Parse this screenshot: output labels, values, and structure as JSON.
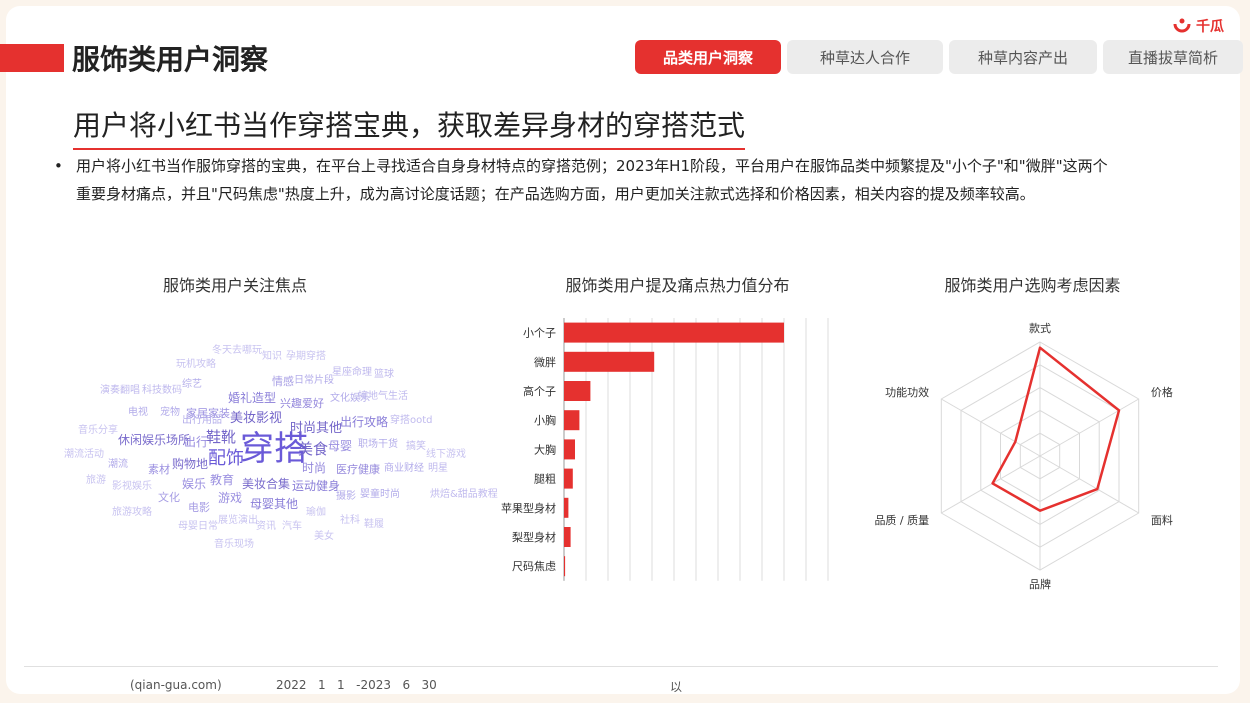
{
  "header": {
    "title": "服饰类用户洞察",
    "logo_text": "千瓜",
    "tabs": [
      {
        "label": "品类用户洞察",
        "active": true
      },
      {
        "label": "种草达人合作",
        "active": false
      },
      {
        "label": "种草内容产出",
        "active": false
      },
      {
        "label": "直播拔草简析",
        "active": false
      }
    ]
  },
  "headline": "用户将小红书当作穿搭宝典，获取差异身材的穿搭范式",
  "bullet": "用户将小红书当作服饰穿搭的宝典，在平台上寻找适合自身身材特点的穿搭范例；2023年H1阶段，平台用户在服饰品类中频繁提及\"小个子\"和\"微胖\"这两个重要身材痛点，并且\"尺码焦虑\"热度上升，成为高讨论度话题；在产品选购方面，用户更加关注款式选择和价格因素，相关内容的提及频率较高。",
  "wordcloud": {
    "title": "服饰类用户关注焦点",
    "words": [
      {
        "text": "穿搭",
        "size": 34,
        "color": "#6a5ad8"
      },
      {
        "text": "配饰",
        "size": 18,
        "color": "#6a5ad8"
      },
      {
        "text": "鞋靴",
        "size": 15,
        "color": "#7466c9"
      },
      {
        "text": "美食",
        "size": 15,
        "color": "#7466c9"
      },
      {
        "text": "美妆影视",
        "size": 13,
        "color": "#7466c9"
      },
      {
        "text": "时尚其他",
        "size": 13,
        "color": "#7466c9"
      },
      {
        "text": "美妆合集",
        "size": 12,
        "color": "#7a6ccc"
      },
      {
        "text": "购物地",
        "size": 12,
        "color": "#7a6ccc"
      },
      {
        "text": "休闲娱乐场所",
        "size": 12,
        "color": "#7a6ccc"
      },
      {
        "text": "婚礼造型",
        "size": 12,
        "color": "#8a7ed8"
      },
      {
        "text": "出行攻略",
        "size": 12,
        "color": "#8a7ed8"
      },
      {
        "text": "运动健身",
        "size": 12,
        "color": "#8a7ed8"
      },
      {
        "text": "母婴其他",
        "size": 12,
        "color": "#8a7ed8"
      },
      {
        "text": "医疗健康",
        "size": 11,
        "color": "#9488dc"
      },
      {
        "text": "时尚",
        "size": 12,
        "color": "#9488dc"
      },
      {
        "text": "兴趣爱好",
        "size": 11,
        "color": "#9488dc"
      },
      {
        "text": "家居家装",
        "size": 11,
        "color": "#9a8fe0"
      },
      {
        "text": "教育",
        "size": 12,
        "color": "#9a8fe0"
      },
      {
        "text": "娱乐",
        "size": 12,
        "color": "#9a8fe0"
      },
      {
        "text": "游戏",
        "size": 12,
        "color": "#9a8fe0"
      },
      {
        "text": "出行",
        "size": 12,
        "color": "#9a8fe0"
      },
      {
        "text": "母婴",
        "size": 12,
        "color": "#9a8fe0"
      },
      {
        "text": "素材",
        "size": 11,
        "color": "#9a8fe0"
      },
      {
        "text": "文化",
        "size": 11,
        "color": "#a79ee4"
      },
      {
        "text": "电影",
        "size": 11,
        "color": "#a79ee4"
      },
      {
        "text": "情感",
        "size": 11,
        "color": "#a79ee4"
      },
      {
        "text": "日常片段",
        "size": 10,
        "color": "#b3acea"
      },
      {
        "text": "文化娱乐",
        "size": 10,
        "color": "#b3acea"
      },
      {
        "text": "综艺",
        "size": 10,
        "color": "#b3acea"
      },
      {
        "text": "出行用品",
        "size": 10,
        "color": "#b3acea"
      },
      {
        "text": "宠物",
        "size": 10,
        "color": "#b3acea"
      },
      {
        "text": "电视",
        "size": 10,
        "color": "#b3acea"
      },
      {
        "text": "潮流",
        "size": 10,
        "color": "#b3acea"
      },
      {
        "text": "职场干货",
        "size": 10,
        "color": "#b3acea"
      },
      {
        "text": "商业财经",
        "size": 10,
        "color": "#b3acea"
      },
      {
        "text": "摄影",
        "size": 10,
        "color": "#b3acea"
      },
      {
        "text": "婴童时尚",
        "size": 10,
        "color": "#b3acea"
      },
      {
        "text": "烘焙&甜品教程",
        "size": 10,
        "color": "#c0baee"
      },
      {
        "text": "穿搭ootd",
        "size": 10,
        "color": "#c0baee"
      },
      {
        "text": "搞笑",
        "size": 10,
        "color": "#c0baee"
      },
      {
        "text": "明星",
        "size": 10,
        "color": "#c0baee"
      },
      {
        "text": "星座命理",
        "size": 10,
        "color": "#c0baee"
      },
      {
        "text": "篮球",
        "size": 10,
        "color": "#c0baee"
      },
      {
        "text": "接地气生活",
        "size": 10,
        "color": "#c0baee"
      },
      {
        "text": "科技数码",
        "size": 10,
        "color": "#c0baee"
      },
      {
        "text": "演奏翻唱",
        "size": 10,
        "color": "#c0baee"
      },
      {
        "text": "玩机攻略",
        "size": 10,
        "color": "#c8c3f0"
      },
      {
        "text": "冬天去哪玩",
        "size": 10,
        "color": "#c8c3f0"
      },
      {
        "text": "知识",
        "size": 10,
        "color": "#c8c3f0"
      },
      {
        "text": "孕期穿搭",
        "size": 10,
        "color": "#c8c3f0"
      },
      {
        "text": "音乐分享",
        "size": 10,
        "color": "#c8c3f0"
      },
      {
        "text": "潮流活动",
        "size": 10,
        "color": "#c8c3f0"
      },
      {
        "text": "旅游",
        "size": 10,
        "color": "#c8c3f0"
      },
      {
        "text": "影视娱乐",
        "size": 10,
        "color": "#c8c3f0"
      },
      {
        "text": "旅游攻略",
        "size": 10,
        "color": "#c8c3f0"
      },
      {
        "text": "母婴日常",
        "size": 10,
        "color": "#c8c3f0"
      },
      {
        "text": "展览演出",
        "size": 10,
        "color": "#c8c3f0"
      },
      {
        "text": "资讯",
        "size": 10,
        "color": "#c8c3f0"
      },
      {
        "text": "汽车",
        "size": 10,
        "color": "#c8c3f0"
      },
      {
        "text": "瑜伽",
        "size": 10,
        "color": "#c8c3f0"
      },
      {
        "text": "社科",
        "size": 10,
        "color": "#c8c3f0"
      },
      {
        "text": "鞋履",
        "size": 10,
        "color": "#c8c3f0"
      },
      {
        "text": "美女",
        "size": 10,
        "color": "#c8c3f0"
      },
      {
        "text": "音乐现场",
        "size": 10,
        "color": "#c8c3f0"
      },
      {
        "text": "线下游戏",
        "size": 10,
        "color": "#c8c3f0"
      }
    ]
  },
  "chart_data": [
    {
      "type": "bar",
      "orientation": "horizontal",
      "title": "服饰类用户提及痛点热力值分布",
      "categories": [
        "小个子",
        "微胖",
        "高个子",
        "小胸",
        "大胸",
        "腿粗",
        "苹果型身材",
        "梨型身材",
        "尺码焦虑"
      ],
      "values": [
        100,
        41,
        12,
        7,
        5,
        4,
        2,
        3,
        0.5
      ],
      "xlim": [
        0,
        120
      ],
      "grid": true,
      "color": "#e5312f"
    },
    {
      "type": "radar",
      "title": "服饰类用户选购考虑因素",
      "axes": [
        "款式",
        "价格",
        "面料",
        "品牌",
        "品质 / 质量",
        "功能功效"
      ],
      "values": [
        95,
        80,
        58,
        48,
        48,
        25
      ],
      "max": 100,
      "rings": 5,
      "color": "#e5312f"
    }
  ],
  "footer": {
    "source": "(qian-gua.com)",
    "range": "2022   1   1   -2023   6   30",
    "note": "以"
  }
}
